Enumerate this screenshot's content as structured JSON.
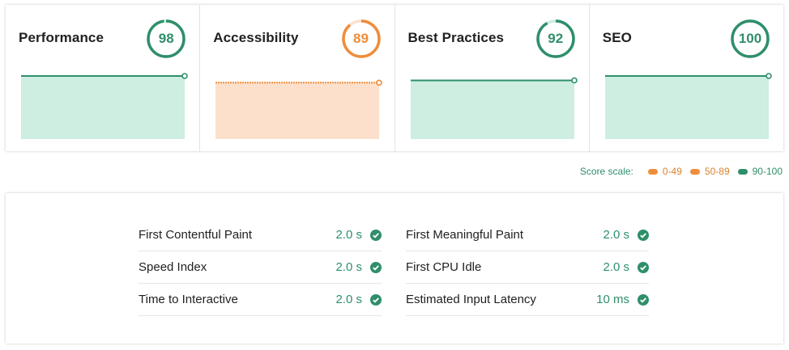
{
  "categories": [
    {
      "title": "Performance",
      "score": "98",
      "fraction": 0.98,
      "status": "pass",
      "color": "#2f8f6a",
      "fill": "#cdeee0"
    },
    {
      "title": "Accessibility",
      "score": "89",
      "fraction": 0.89,
      "status": "average",
      "color": "#ef8d3c",
      "fill": "#fde0cc"
    },
    {
      "title": "Best Practices",
      "score": "92",
      "fraction": 0.92,
      "status": "pass",
      "color": "#2f8f6a",
      "fill": "#cdeee0"
    },
    {
      "title": "SEO",
      "score": "100",
      "fraction": 1.0,
      "status": "pass",
      "color": "#2f8f6a",
      "fill": "#cdeee0"
    }
  ],
  "scale": {
    "label": "Score scale:",
    "items": [
      {
        "label": "0-49",
        "color": "#ef8d3c"
      },
      {
        "label": "50-89",
        "color": "#ef8d3c"
      },
      {
        "label": "90-100",
        "color": "#2f8f6a"
      }
    ]
  },
  "metrics": {
    "left": [
      {
        "label": "First Contentful Paint",
        "value": "2.0 s"
      },
      {
        "label": "Speed Index",
        "value": "2.0 s"
      },
      {
        "label": "Time to Interactive",
        "value": "2.0 s"
      }
    ],
    "right": [
      {
        "label": "First Meaningful Paint",
        "value": "2.0 s"
      },
      {
        "label": "First CPU Idle",
        "value": "2.0 s"
      },
      {
        "label": "Estimated Input Latency",
        "value": "10 ms"
      }
    ]
  },
  "icons": {
    "check": "check-circle-icon"
  },
  "colors": {
    "pass": "#2f8f6a",
    "average": "#ef8d3c"
  }
}
